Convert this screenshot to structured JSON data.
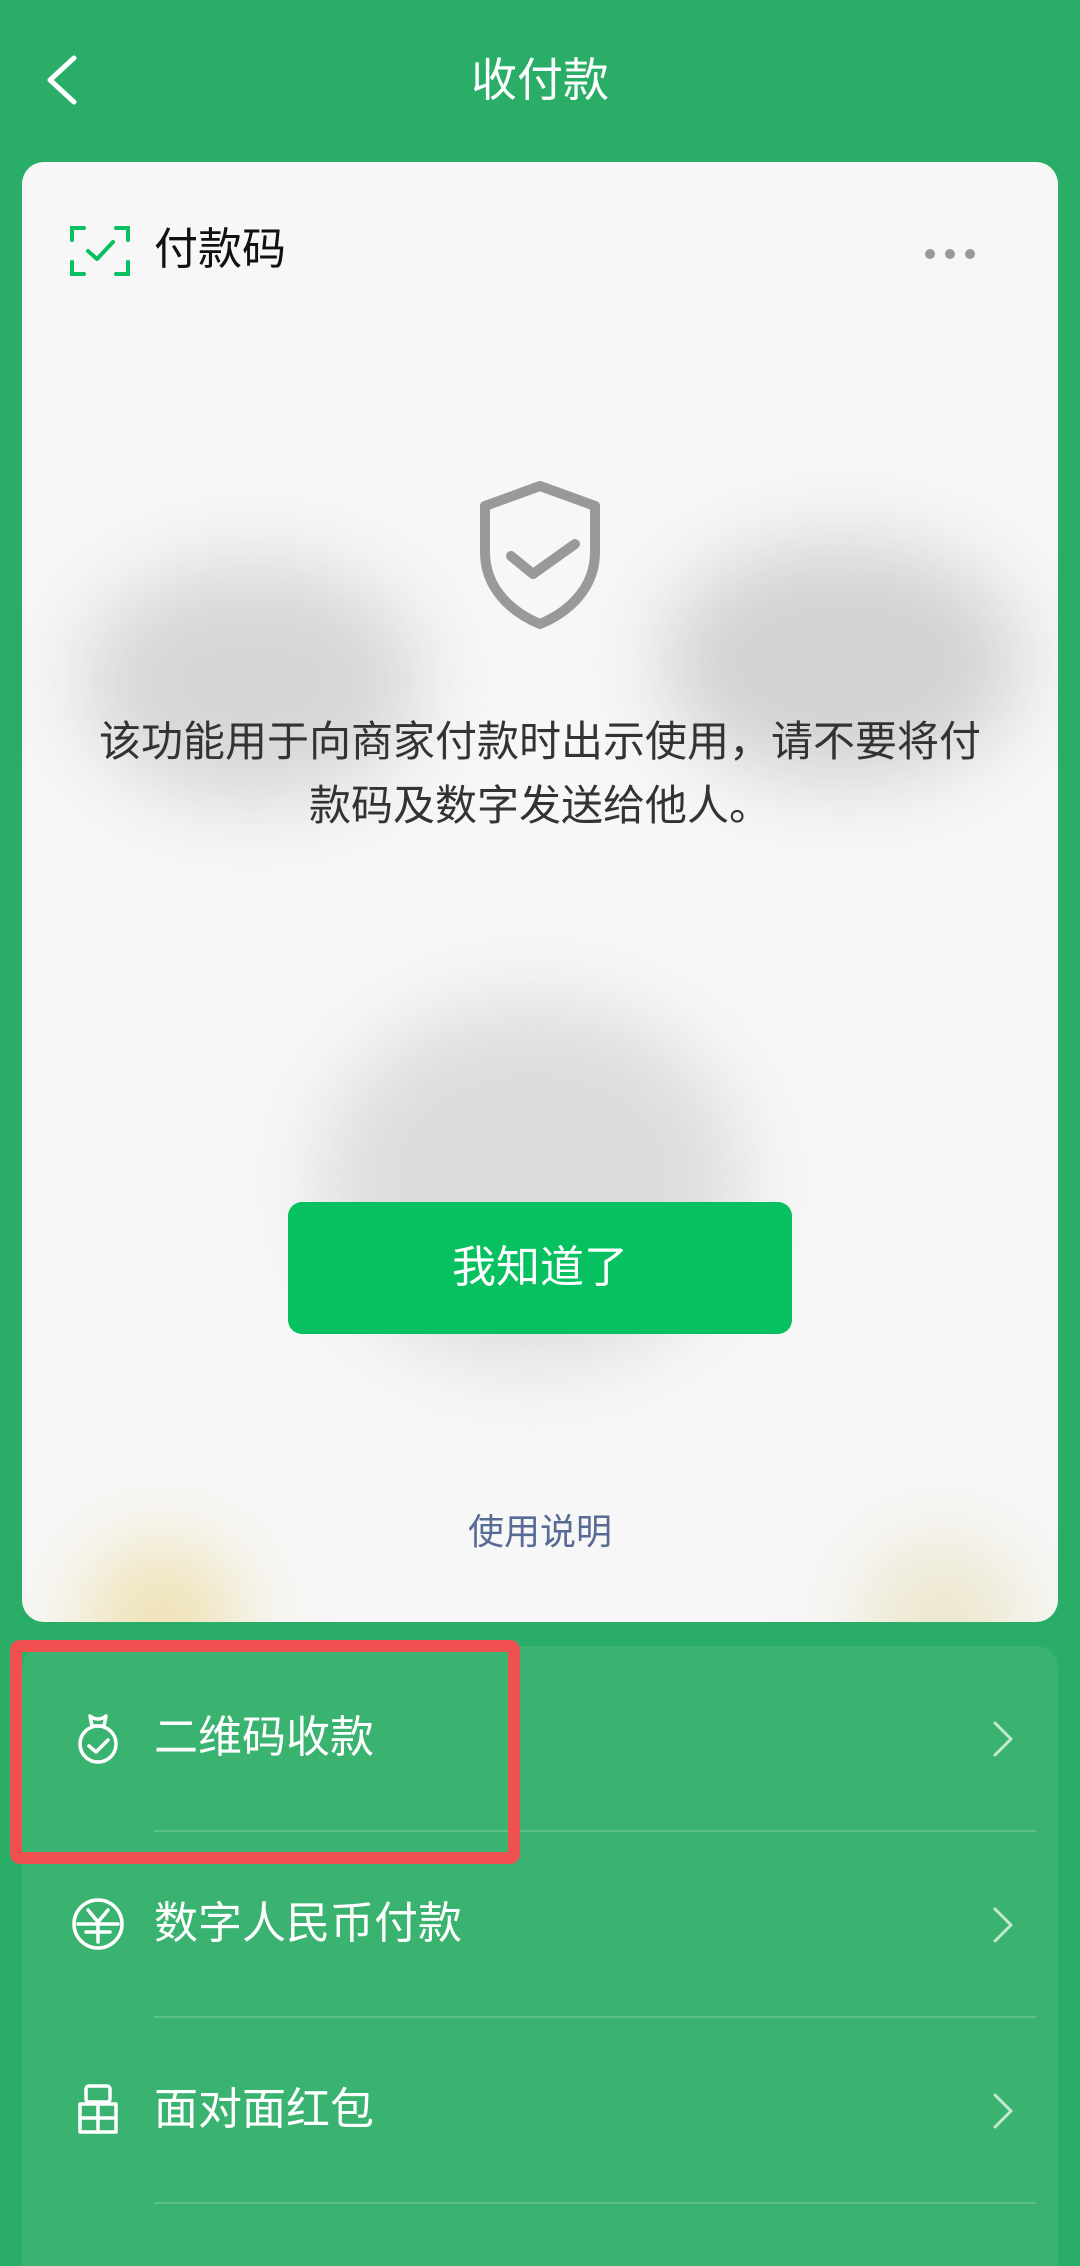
{
  "header": {
    "title": "收付款"
  },
  "card": {
    "title": "付款码",
    "notice": "该功能用于向商家付款时出示使用，请不要将付款码及数字发送给他人。",
    "ok_button": "我知道了",
    "help_link": "使用说明"
  },
  "menu": {
    "items": [
      {
        "label": "二维码收款",
        "icon": "money-bag-icon"
      },
      {
        "label": "数字人民币付款",
        "icon": "digital-rmb-icon"
      },
      {
        "label": "面对面红包",
        "icon": "red-packet-icon"
      }
    ]
  },
  "colors": {
    "background": "#2AAE67",
    "primary_button": "#07C160",
    "link": "#576B95",
    "highlight": "#F05050"
  }
}
